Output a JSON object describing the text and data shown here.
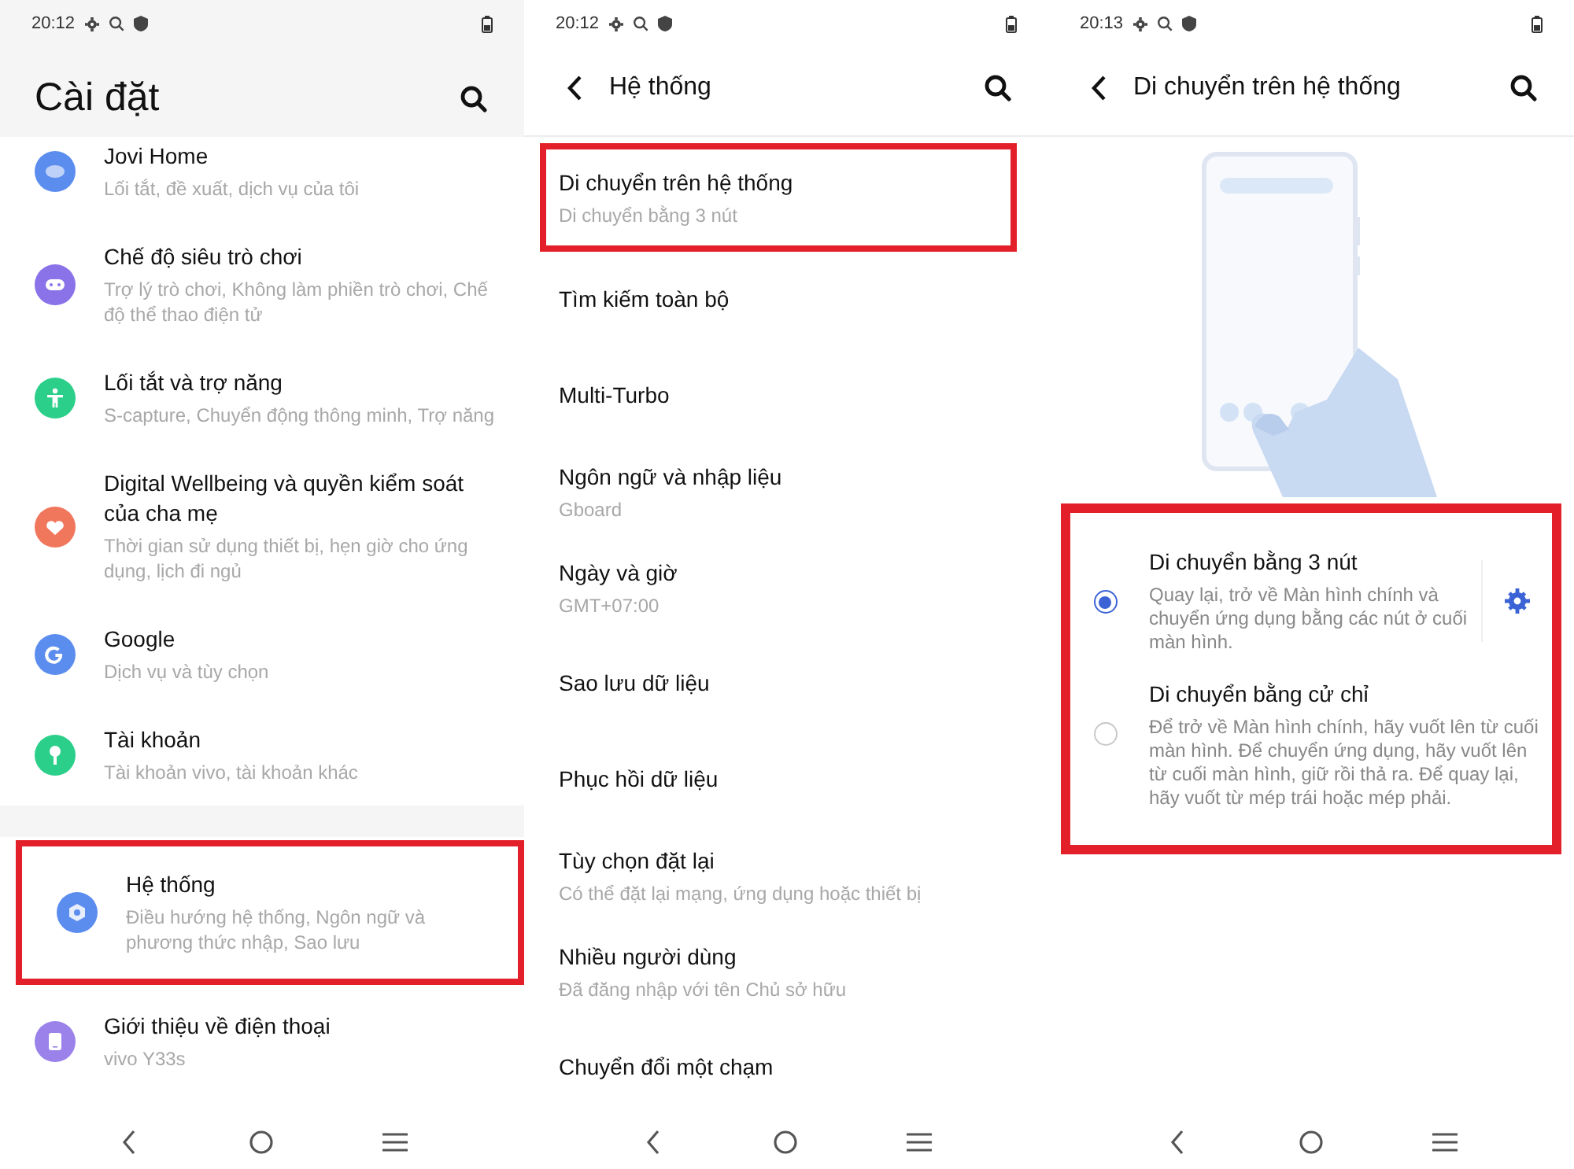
{
  "screens": [
    {
      "kind": "settings",
      "status_time": "20:12",
      "title": "Cài đặt",
      "groups": [
        {
          "items": [
            {
              "title": "Jovi Home",
              "subtitle": "Lối tắt, đề xuất, dịch vụ của tôi",
              "color": "#5b8def",
              "highlighted": false
            },
            {
              "title": "Chế độ siêu trò chơi",
              "subtitle": "Trợ lý trò chơi, Không làm phiền trò chơi, Chế độ thể thao điện tử",
              "color": "#8a72e8",
              "highlighted": false
            },
            {
              "title": "Lối tắt và trợ năng",
              "subtitle": "S-capture, Chuyển động thông minh, Trợ năng",
              "color": "#2bcf8a",
              "highlighted": false
            },
            {
              "title": "Digital Wellbeing và quyền kiểm soát của cha mẹ",
              "subtitle": "Thời gian sử dụng thiết bị, hẹn giờ cho ứng dụng, lịch đi ngủ",
              "color": "#f0775c",
              "highlighted": false
            },
            {
              "title": "Google",
              "subtitle": "Dịch vụ và tùy chọn",
              "color": "#5b8def",
              "highlighted": false
            },
            {
              "title": "Tài khoản",
              "subtitle": "Tài khoản vivo, tài khoản khác",
              "color": "#2bcf8a",
              "highlighted": false
            }
          ]
        },
        {
          "items": [
            {
              "title": "Hệ thống",
              "subtitle": "Điều hướng hệ thống, Ngôn ngữ và phương thức nhập, Sao lưu",
              "color": "#5b8def",
              "highlighted": true
            },
            {
              "title": "Giới thiệu về điện thoại",
              "subtitle": "vivo Y33s",
              "color": "#9a82ea",
              "highlighted": false
            }
          ]
        }
      ]
    },
    {
      "kind": "list",
      "status_time": "20:12",
      "title": "Hệ thống",
      "items": [
        {
          "title": "Di chuyển trên hệ thống",
          "subtitle": "Di chuyển bằng 3 nút",
          "highlighted": true
        },
        {
          "title": "Tìm kiếm toàn bộ",
          "highlighted": false
        },
        {
          "title": "Multi-Turbo",
          "highlighted": false
        },
        {
          "title": "Ngôn ngữ và nhập liệu",
          "subtitle": "Gboard",
          "highlighted": false
        },
        {
          "title": "Ngày và giờ",
          "subtitle": "GMT+07:00",
          "highlighted": false
        },
        {
          "title": "Sao lưu dữ liệu",
          "highlighted": false
        },
        {
          "title": "Phục hồi dữ liệu",
          "highlighted": false
        },
        {
          "title": "Tùy chọn đặt lại",
          "subtitle": "Có thể đặt lại mạng, ứng dụng hoặc thiết bị",
          "highlighted": false
        },
        {
          "title": "Nhiều người dùng",
          "subtitle": "Đã đăng nhập với tên Chủ sở hữu",
          "highlighted": false
        },
        {
          "title": "Chuyển đổi một chạm",
          "highlighted": false
        }
      ]
    },
    {
      "kind": "options",
      "status_time": "20:13",
      "title": "Di chuyển trên hệ thống",
      "highlighted": true,
      "options": [
        {
          "title": "Di chuyển bằng 3 nút",
          "description": "Quay lại, trở về Màn hình chính và chuyển ứng dụng bằng các nút ở cuối màn hình.",
          "selected": true,
          "has_settings": true
        },
        {
          "title": "Di chuyển bằng cử chỉ",
          "description": "Để trở về Màn hình chính, hãy vuốt lên từ cuối màn hình. Để chuyển ứng dụng, hãy vuốt lên từ cuối màn hình, giữ rồi thả ra. Để quay lại, hãy vuốt từ mép trái hoặc mép phải.",
          "selected": false,
          "has_settings": false
        }
      ]
    }
  ]
}
